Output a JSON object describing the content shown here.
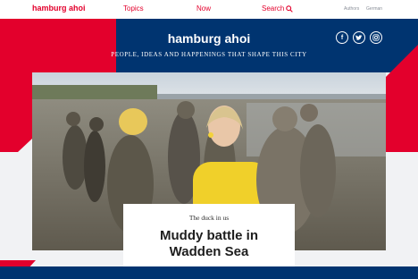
{
  "nav": {
    "brand": "hamburg ahoi",
    "topics": "Topics",
    "now": "Now",
    "search": "Search",
    "authors": "Authors",
    "language": "German"
  },
  "hero": {
    "title": "hamburg ahoi",
    "subtitle": "PEOPLE, IDEAS AND HAPPENINGS THAT SHAPE THIS CITY"
  },
  "social": {
    "facebook": "f",
    "twitter": "twitter-icon",
    "instagram": "instagram-icon"
  },
  "article": {
    "kicker": "The duck in us",
    "headline_line1": "Muddy battle in",
    "headline_line2": "Wadden Sea"
  },
  "colors": {
    "brand_red": "#e3002c",
    "navy": "#003470",
    "background": "#f1f2f4"
  }
}
